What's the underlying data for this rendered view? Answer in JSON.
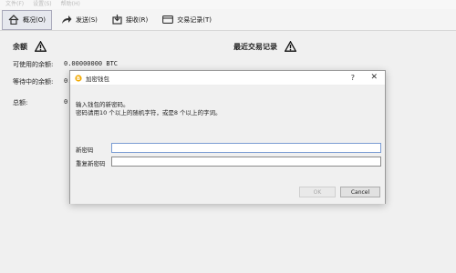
{
  "menu": [
    "文件(F)",
    "设置(S)",
    "帮助(H)"
  ],
  "toolbar": {
    "tabs": [
      {
        "label": "概况(O)",
        "icon": "home-icon"
      },
      {
        "label": "发送(S)",
        "icon": "send-arrow-icon"
      },
      {
        "label": "接收(R)",
        "icon": "receive-icon"
      },
      {
        "label": "交易记录(T)",
        "icon": "transactions-icon"
      }
    ]
  },
  "overview": {
    "balance_title": "余额",
    "available_label": "可使用的余额:",
    "available_value": "0.00000000 BTC",
    "pending_label": "等待中的余额:",
    "pending_value": "0.",
    "total_label": "总额:",
    "total_value": "0",
    "recent_title": "最近交易记录"
  },
  "dialog": {
    "title": "加密钱包",
    "help": "?",
    "close": "✕",
    "instruction_line1": "输入钱包的新密码。",
    "instruction_line2": "密码请用10 个以上的随机字符，或是8 个以上的字词。",
    "new_pass_label": "新密码",
    "repeat_pass_label": "重复新密码",
    "ok": "OK",
    "cancel": "Cancel"
  },
  "colors": {
    "warning": "#111111",
    "field_focus": "#7a9cd3"
  }
}
